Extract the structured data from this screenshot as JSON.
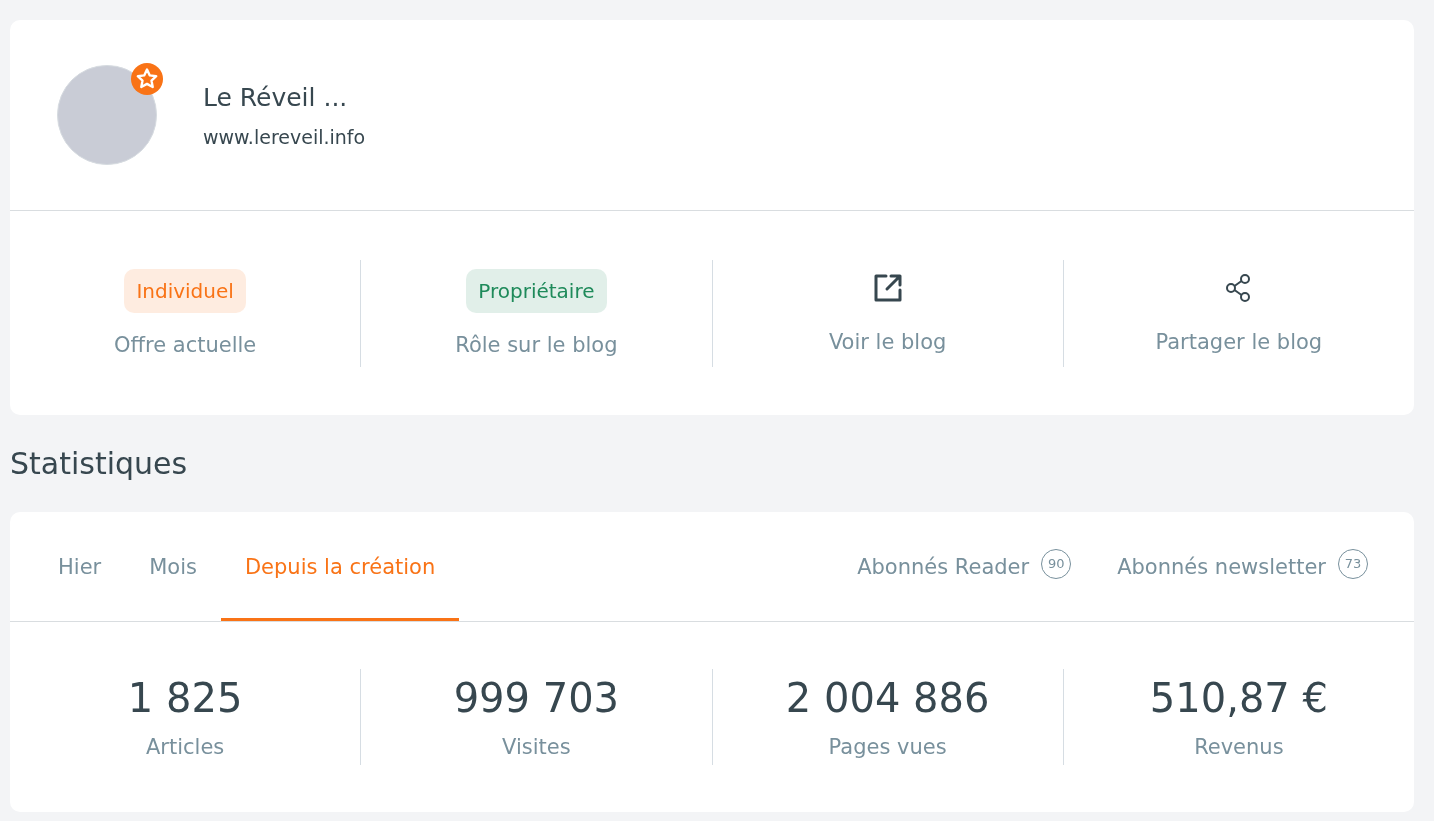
{
  "blog": {
    "name": "Le Réveil ...",
    "url": "www.lereveil.info",
    "featured": true
  },
  "info": [
    {
      "kind": "badge",
      "value": "Individuel",
      "color": "#f97316",
      "label": "Offre actuelle"
    },
    {
      "kind": "badge",
      "value": "Propriétaire",
      "color": "#1e8a5a",
      "label": "Rôle sur le blog"
    },
    {
      "kind": "open-link",
      "label": "Voir le blog"
    },
    {
      "kind": "share",
      "label": "Partager le blog"
    }
  ],
  "section_title": "Statistiques",
  "tabs": [
    {
      "label": "Hier",
      "selected": false
    },
    {
      "label": "Mois",
      "selected": false
    },
    {
      "label": "Depuis la création",
      "selected": true
    }
  ],
  "subscribers": [
    {
      "label": "Abonnés Reader",
      "count": "90"
    },
    {
      "label": "Abonnés newsletter",
      "count": "73"
    }
  ],
  "stats": [
    {
      "value": "1 825",
      "label": "Articles"
    },
    {
      "value": "999 703",
      "label": "Visites"
    },
    {
      "value": "2 004 886",
      "label": "Pages vues"
    },
    {
      "value": "510,87 €",
      "label": "Revenus"
    }
  ]
}
